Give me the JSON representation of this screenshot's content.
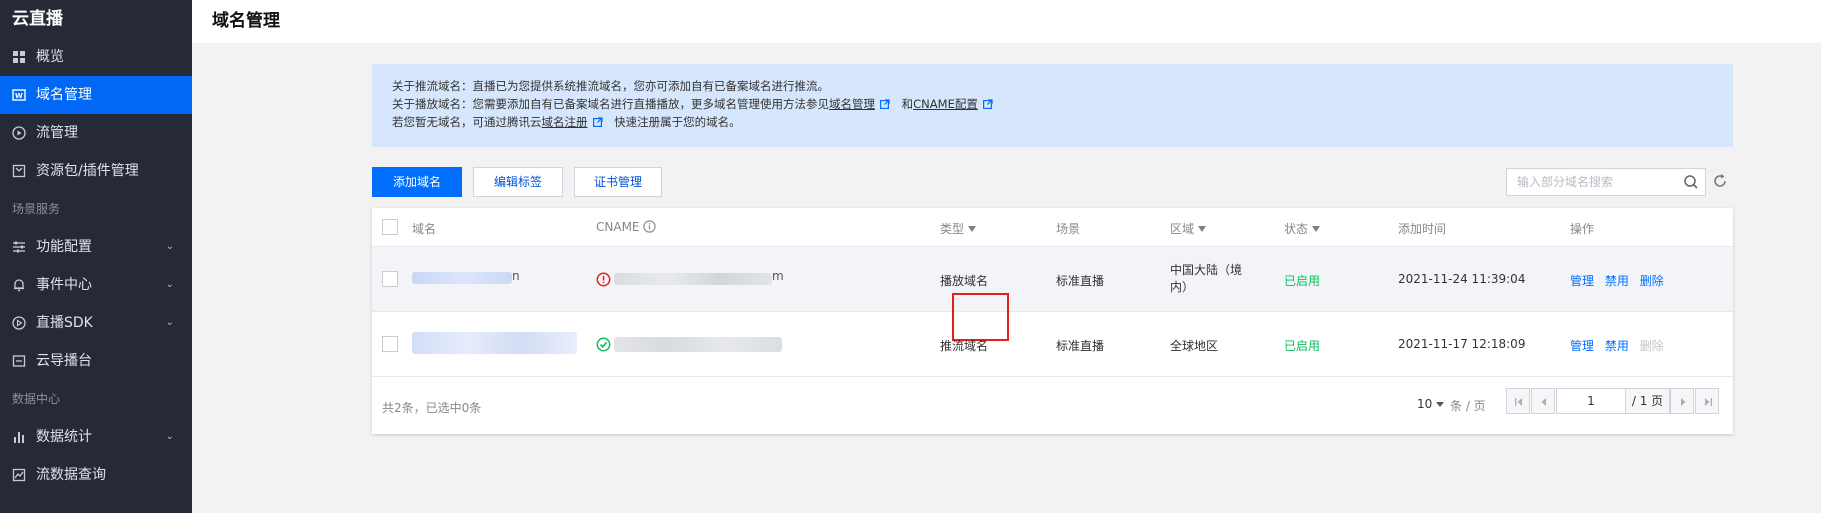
{
  "app": {
    "brand": "云直播"
  },
  "sidebar": {
    "items": [
      {
        "label": "概览",
        "icon": "grid-icon"
      },
      {
        "label": "域名管理",
        "icon": "domain-icon",
        "active": true
      },
      {
        "label": "流管理",
        "icon": "play-circle-icon"
      },
      {
        "label": "资源包/插件管理",
        "icon": "package-icon"
      }
    ],
    "group1_title": "场景服务",
    "group1": [
      {
        "label": "功能配置",
        "icon": "sliders-icon"
      },
      {
        "label": "事件中心",
        "icon": "bell-icon"
      },
      {
        "label": "直播SDK",
        "icon": "sdk-play-icon"
      },
      {
        "label": "云导播台",
        "icon": "monitor-icon"
      }
    ],
    "group2_title": "数据中心",
    "group2": [
      {
        "label": "数据统计",
        "icon": "bar-chart-icon"
      },
      {
        "label": "流数据查询",
        "icon": "line-chart-icon"
      }
    ]
  },
  "header": {
    "title": "域名管理"
  },
  "notice": {
    "line1": "关于推流域名：直播已为您提供系统推流域名，您亦可添加自有已备案域名进行推流。",
    "line2_prefix": "关于播放域名：您需要添加自有已备案域名进行直播播放，更多域名管理使用方法参见",
    "line2_link1": "域名管理",
    "line2_mid": "和",
    "line2_link2": "CNAME配置",
    "line3_prefix": "若您暂无域名，可通过腾讯云",
    "line3_link": "域名注册",
    "line3_suffix": "快速注册属于您的域名。"
  },
  "toolbar": {
    "add_label": "添加域名",
    "edit_tags_label": "编辑标签",
    "cert_label": "证书管理",
    "search_placeholder": "输入部分域名搜索"
  },
  "table": {
    "columns": {
      "domain": "域名",
      "cname": "CNAME",
      "type": "类型",
      "scene": "场景",
      "region": "区域",
      "status": "状态",
      "added": "添加时间",
      "ops": "操作"
    },
    "rows": [
      {
        "domain_tail": "n",
        "cname_tail": "m",
        "cname_status": "warning",
        "type": "播放域名",
        "scene": "标准直播",
        "region_line1": "中国大陆（境",
        "region_line2": "内）",
        "status": "已启用",
        "added": "2021-11-24 11:39:04",
        "op_manage": "管理",
        "op_disable": "禁用",
        "op_delete": "删除",
        "delete_disabled": false
      },
      {
        "domain_tail": "",
        "cname_tail": "",
        "cname_status": "ok",
        "type": "推流域名",
        "scene": "标准直播",
        "region_line1": "全球地区",
        "region_line2": "",
        "status": "已启用",
        "added": "2021-11-17 12:18:09",
        "op_manage": "管理",
        "op_disable": "禁用",
        "op_delete": "删除",
        "delete_disabled": true
      }
    ]
  },
  "footer": {
    "total": "共2条，已选中0条",
    "page_size": "10",
    "per_page_label": "条 / 页",
    "current_page": "1",
    "total_pages": "/ 1 页"
  },
  "colors": {
    "primary": "#006eff",
    "sidebar_bg": "#252a36",
    "active_nav": "#0068f5",
    "enabled_green": "#0abf5b",
    "warning_red": "#e51e1e",
    "notice_bg": "#d6e6fc"
  }
}
